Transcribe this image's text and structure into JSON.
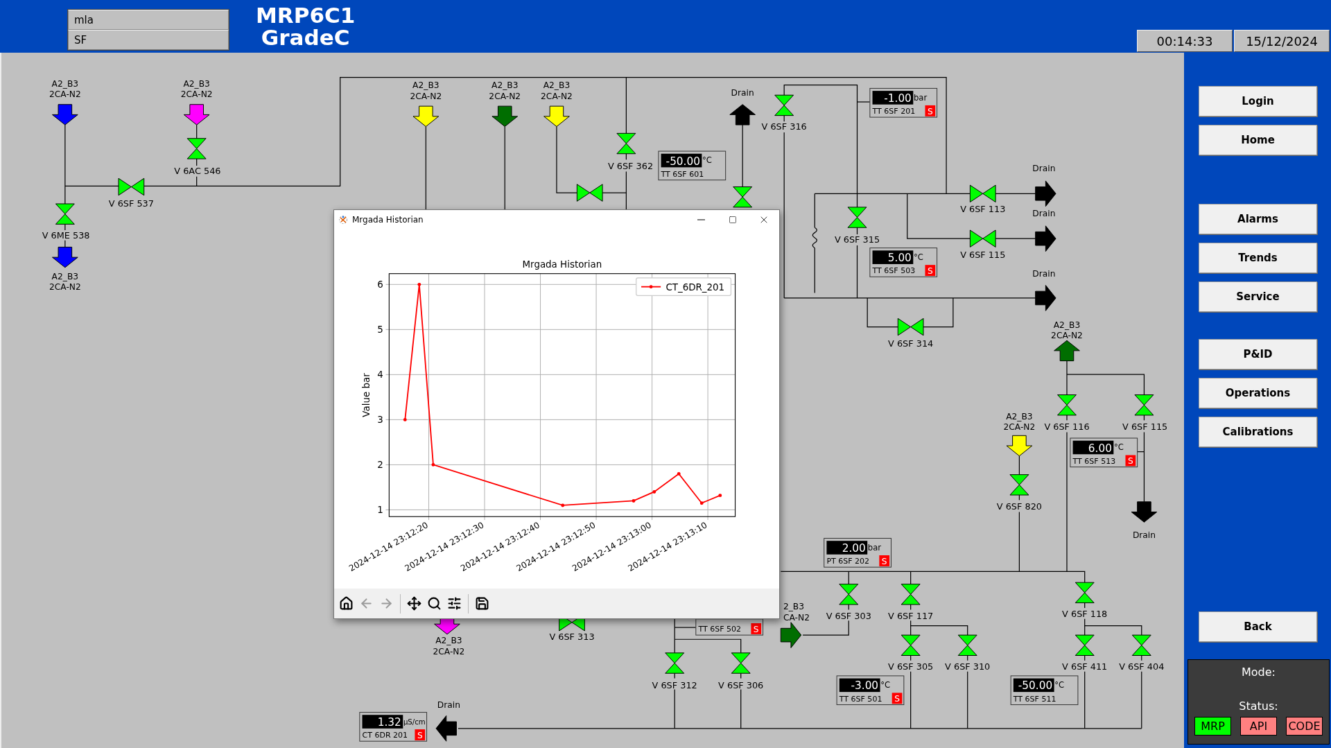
{
  "header": {
    "fields": [
      "mla",
      "SF"
    ],
    "title_lines": [
      "MRP6C1",
      "GradeC"
    ],
    "time": "00:14:33",
    "date": "15/12/2024"
  },
  "pid": {
    "sources": [
      {
        "label_lines": [
          "A2_B3",
          "2CA-N2"
        ],
        "color": "#0000ff",
        "kind": "down"
      },
      {
        "label_lines": [
          "A2_B3",
          "2CA-N2"
        ],
        "color": "#ff00ff",
        "kind": "down"
      },
      {
        "label_lines": [
          "A2_B3",
          "2CA-N2"
        ],
        "color": "#ffff00",
        "kind": "down"
      },
      {
        "label_lines": [
          "A2_B3",
          "2CA-N2"
        ],
        "color": "#006e00",
        "kind": "down"
      },
      {
        "label_lines": [
          "A2_B3",
          "2CA-N2"
        ],
        "color": "#ffff00",
        "kind": "down"
      },
      {
        "label_lines": [
          "A2_B3",
          "2CA-N2"
        ],
        "color": "#0000ff",
        "kind": "down"
      },
      {
        "label_lines": [
          "A2_B3",
          "2CA-N2"
        ],
        "color": "#006e00",
        "kind": "up"
      },
      {
        "label_lines": [
          "A2_B3",
          "2CA-N2"
        ],
        "color": "#ffff00",
        "kind": "down"
      },
      {
        "label_lines": [
          "2_B3",
          "CA-N2"
        ],
        "color": "#006e00",
        "kind": "right"
      },
      {
        "label_lines": [
          "A2_B3",
          "2CA-N2"
        ],
        "color": "#ff00ff",
        "kind": "down"
      }
    ],
    "drains": [
      {
        "label": "Drain",
        "kind": "up"
      },
      {
        "label": "Drain",
        "kind": "right"
      },
      {
        "label": "Drain",
        "kind": "right"
      },
      {
        "label": "Drain",
        "kind": "right"
      },
      {
        "label": "Drain",
        "kind": "down"
      },
      {
        "label": "Drain",
        "kind": "left"
      }
    ],
    "valves": [
      {
        "label": "V 6AC 546",
        "kind": "vertical"
      },
      {
        "label": "V 6SF 537",
        "kind": "horizontal"
      },
      {
        "label": "V 6ME 538",
        "kind": "vertical"
      },
      {
        "label": "V 6SF 362",
        "kind": "vertical"
      },
      {
        "kind": "horizontal"
      },
      {
        "kind": "vertical"
      },
      {
        "label": "V 6SF 316",
        "kind": "vertical"
      },
      {
        "label": "V 6SF 113",
        "kind": "horizontal"
      },
      {
        "label": "V 6SF 315",
        "kind": "vertical"
      },
      {
        "label": "V 6SF 115",
        "kind": "horizontal"
      },
      {
        "label": "V 6SF 314",
        "kind": "horizontal"
      },
      {
        "label": "V 6SF 116",
        "kind": "vertical"
      },
      {
        "label": "V 6SF 115",
        "kind": "vertical"
      },
      {
        "label": "V 6SF 820",
        "kind": "vertical"
      },
      {
        "label": "V 6SF 303",
        "kind": "vertical"
      },
      {
        "label": "V 6SF 117",
        "kind": "vertical"
      },
      {
        "label": "V 6SF 118",
        "kind": "vertical"
      },
      {
        "label": "V 6SF 305",
        "kind": "vertical"
      },
      {
        "label": "V 6SF 310",
        "kind": "vertical"
      },
      {
        "label": "V 6SF 411",
        "kind": "vertical"
      },
      {
        "label": "V 6SF 404",
        "kind": "vertical"
      },
      {
        "label": "V 6SF 312",
        "kind": "vertical"
      },
      {
        "label": "V 6SF 306",
        "kind": "vertical"
      },
      {
        "label": "V 6SF 313",
        "kind": "horizontal"
      }
    ],
    "instruments": [
      {
        "value": "-50.00",
        "unit": "°C",
        "tag": "TT 6SF 601"
      },
      {
        "value": "-1.00",
        "unit": "bar",
        "tag": "TT 6SF 201",
        "status": "S"
      },
      {
        "value": "5.00",
        "unit": "°C",
        "tag": "TT 6SF 503",
        "status": "S"
      },
      {
        "value": "6.00",
        "unit": "°C",
        "tag": "TT 6SF 513",
        "status": "S"
      },
      {
        "value": "2.00",
        "unit": "bar",
        "tag": "PT 6SF 202",
        "status": "S"
      },
      {
        "tag": "TT 6SF 502",
        "status": "S"
      },
      {
        "value": "-3.00",
        "unit": "°C",
        "tag": "TT 6SF 501",
        "status": "S"
      },
      {
        "value": "-50.00",
        "unit": "°C",
        "tag": "TT 6SF 511"
      },
      {
        "value": "1.32",
        "unit": "µS/cm",
        "tag": "CT 6DR 201",
        "status": "S"
      }
    ]
  },
  "historian": {
    "title": "Mrgada Historian",
    "toolbar": [
      {
        "kind": "home",
        "disabled": false
      },
      {
        "kind": "back",
        "disabled": true
      },
      {
        "kind": "forward",
        "disabled": true
      },
      {
        "kind": "pan",
        "disabled": false
      },
      {
        "kind": "zoom",
        "disabled": false
      },
      {
        "kind": "configure",
        "disabled": false
      },
      {
        "kind": "save",
        "disabled": false
      }
    ],
    "chart_data": {
      "type": "line",
      "title": "Mrgada Historian",
      "ylabel": "Value bar",
      "x": [
        "2024-12-14 23:12:15.75",
        "2024-12-14 23:12:18.3",
        "2024-12-14 23:12:20.8",
        "2024-12-14 23:12:44.0",
        "2024-12-14 23:12:56.7",
        "2024-12-14 23:13:00.4",
        "2024-12-14 23:13:04.8",
        "2024-12-14 23:13:08.9",
        "2024-12-14 23:13:12.2"
      ],
      "series": [
        {
          "name": "CT_6DR_201",
          "color": "#ff0000",
          "values": [
            3,
            6,
            2,
            1.1,
            1.2,
            1.4,
            1.8,
            1.15,
            1.32
          ]
        }
      ],
      "xlim": [
        "2024-12-14 23:12:12.9",
        "2024-12-14 23:13:14.9"
      ],
      "ylim": [
        0.85,
        6.24
      ],
      "xticks": [
        "2024-12-14 23:12:20",
        "2024-12-14 23:12:30",
        "2024-12-14 23:12:40",
        "2024-12-14 23:12:50",
        "2024-12-14 23:13:00",
        "2024-12-14 23:13:10"
      ],
      "yticks": [
        1,
        2,
        3,
        4,
        5,
        6
      ],
      "grid": true
    }
  },
  "sidebar": {
    "groups": [
      [
        "Login",
        "Home"
      ],
      [
        "Alarms",
        "Trends",
        "Service"
      ],
      [
        "P&ID",
        "Operations",
        "Calibrations"
      ]
    ],
    "back": "Back",
    "mode_panel": {
      "mode_label": "Mode:",
      "status_label": "Status:",
      "badges": [
        {
          "label": "MRP",
          "color": "#00ff00"
        },
        {
          "label": "API",
          "color": "#ff8080"
        },
        {
          "label": "CODE",
          "color": "#ff8080"
        }
      ]
    }
  }
}
